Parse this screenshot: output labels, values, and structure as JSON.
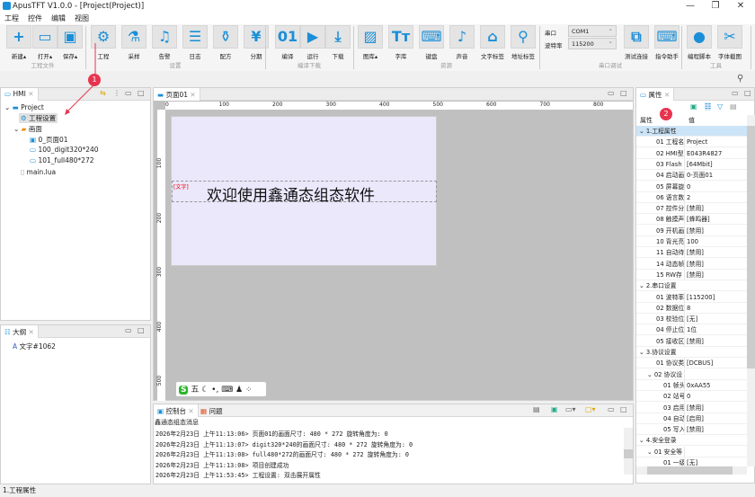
{
  "window": {
    "title": "ApusTFT V1.0.0 - [Project(Project)]",
    "min": "—",
    "max": "❐",
    "close": "✕"
  },
  "menu": [
    "工程",
    "控件",
    "编辑",
    "视图"
  ],
  "ribbon": {
    "groups": [
      "工程文件",
      "设置",
      "编译下载",
      "资源",
      "串口调试",
      "工具"
    ],
    "buttons": [
      {
        "label": "新建▴",
        "icon": "new-file-icon",
        "glyph": "+"
      },
      {
        "label": "打开▴",
        "icon": "open-folder-icon",
        "glyph": "▭"
      },
      {
        "label": "保存▴",
        "icon": "save-icon",
        "glyph": "▣"
      },
      {
        "label": "工程",
        "icon": "gear-icon",
        "glyph": "⚙"
      },
      {
        "label": "采样",
        "icon": "test-tube-icon",
        "glyph": "⚗"
      },
      {
        "label": "告警",
        "icon": "bell-icon",
        "glyph": "♫"
      },
      {
        "label": "日志",
        "icon": "log-icon",
        "glyph": "☰"
      },
      {
        "label": "配方",
        "icon": "recipe-icon",
        "glyph": "⚱"
      },
      {
        "label": "分期",
        "icon": "installment-icon",
        "glyph": "¥"
      },
      {
        "label": "编译",
        "icon": "compile-icon",
        "glyph": "01"
      },
      {
        "label": "运行",
        "icon": "play-icon",
        "glyph": "▶"
      },
      {
        "label": "下载",
        "icon": "download-icon",
        "glyph": "⤓"
      },
      {
        "label": "图库▴",
        "icon": "image-icon",
        "glyph": "▨"
      },
      {
        "label": "字库",
        "icon": "font-icon",
        "glyph": "Tт"
      },
      {
        "label": "键盘",
        "icon": "keyboard-icon",
        "glyph": "⌨"
      },
      {
        "label": "声音",
        "icon": "music-icon",
        "glyph": "♪"
      },
      {
        "label": "文字标签",
        "icon": "tag-icon",
        "glyph": "⌂"
      },
      {
        "label": "地址标签",
        "icon": "location-icon",
        "glyph": "⚲"
      },
      {
        "label": "测试连接",
        "icon": "network-icon",
        "glyph": "⧉"
      },
      {
        "label": "指令助手",
        "icon": "command-icon",
        "glyph": "⌨"
      },
      {
        "label": "编程脚本",
        "icon": "lua-icon",
        "glyph": "●"
      },
      {
        "label": "字体截图",
        "icon": "scissors-icon",
        "glyph": "✂"
      }
    ],
    "serial": {
      "port_label": "串口",
      "port_value": "COM1",
      "baud_label": "波特率",
      "baud_value": "115200"
    }
  },
  "hmi_panel": {
    "tab": "HMI",
    "tree": [
      "Project",
      "工程设置",
      "画面",
      "0_页面01",
      "100_digit320*240",
      "101_full480*272",
      "main.lua"
    ]
  },
  "outline_panel": {
    "tab": "大纲",
    "items": [
      "文字#1062"
    ]
  },
  "editor": {
    "tab": "页面01",
    "ruler_h": [
      "0",
      "100",
      "200",
      "300",
      "400",
      "500",
      "600",
      "700",
      "800"
    ],
    "ruler_v": [
      "100",
      "200",
      "300",
      "400",
      "500"
    ],
    "tag": "[文字]",
    "text": "欢迎使用鑫通态组态软件",
    "ime": "五"
  },
  "console": {
    "tabs": [
      "控制台",
      "问题"
    ],
    "header": "鑫通态组态消息",
    "lines": [
      "2026年2月23日 上午11:13:06> 页面01的画面尺寸: 480 * 272  旋转角度为: 0",
      "2026年2月23日 上午11:13:07> digit320*240的画面尺寸: 480 * 272  旋转角度为: 0",
      "2026年2月23日 上午11:13:08> full480*272的画面尺寸: 480 * 272  旋转角度为: 0",
      "2026年2月23日 上午11:13:08> 项目创建成功",
      "2026年2月23日 上午11:53:45> 工程设置: 双击展开属性"
    ]
  },
  "properties": {
    "tab": "属性",
    "col_key": "属性",
    "col_val": "值",
    "rows": [
      {
        "k": "⌄ 1.工程属性",
        "v": "",
        "lvl": 0,
        "sel": true
      },
      {
        "k": "01 工程名",
        "v": "Project",
        "lvl": 2
      },
      {
        "k": "02 HMI型",
        "v": "E043R4827",
        "lvl": 2
      },
      {
        "k": "03 Flash",
        "v": "[64Mbit]",
        "lvl": 2
      },
      {
        "k": "04 启动画",
        "v": "0-页面01",
        "lvl": 2
      },
      {
        "k": "05 屏幕旋",
        "v": "0",
        "lvl": 2
      },
      {
        "k": "06 语言数",
        "v": "2",
        "lvl": 2
      },
      {
        "k": "07 控件分",
        "v": "[禁用]",
        "lvl": 2
      },
      {
        "k": "08 触摸声",
        "v": "[蜂鸣器]",
        "lvl": 2
      },
      {
        "k": "09 开机画",
        "v": "[禁用]",
        "lvl": 2
      },
      {
        "k": "10 背光亮",
        "v": "100",
        "lvl": 2
      },
      {
        "k": "11 自动待",
        "v": "[禁用]",
        "lvl": 2
      },
      {
        "k": "14 动态帧",
        "v": "[禁用]",
        "lvl": 2
      },
      {
        "k": "15 RW存",
        "v": "[禁用]",
        "lvl": 2
      },
      {
        "k": "⌄ 2.串口设置",
        "v": "",
        "lvl": 0
      },
      {
        "k": "01 波特率",
        "v": "[115200]",
        "lvl": 2
      },
      {
        "k": "02 数据位",
        "v": "8",
        "lvl": 2
      },
      {
        "k": "03 校验位",
        "v": "[无]",
        "lvl": 2
      },
      {
        "k": "04 停止位",
        "v": "1位",
        "lvl": 2
      },
      {
        "k": "05 接收区",
        "v": "[禁用]",
        "lvl": 2
      },
      {
        "k": "⌄ 3.协议设置",
        "v": "",
        "lvl": 0
      },
      {
        "k": "01 协议类",
        "v": "[DCBUS]",
        "lvl": 2
      },
      {
        "k": "⌄ 02 协议设",
        "v": "",
        "lvl": 1
      },
      {
        "k": "01 帧头",
        "v": "0xAA55",
        "lvl": 3
      },
      {
        "k": "02 站号",
        "v": "0",
        "lvl": 3
      },
      {
        "k": "03 启用",
        "v": "[禁用]",
        "lvl": 3
      },
      {
        "k": "04 自动",
        "v": "[启用]",
        "lvl": 3
      },
      {
        "k": "05 写入",
        "v": "[禁用]",
        "lvl": 3
      },
      {
        "k": "⌄ 4.安全登录",
        "v": "",
        "lvl": 0
      },
      {
        "k": "⌄ 01 安全等",
        "v": "",
        "lvl": 1
      },
      {
        "k": "01 一级",
        "v": "[无]",
        "lvl": 3
      }
    ]
  },
  "statusbar": {
    "text": "1.工程属性"
  },
  "annotations": [
    "1",
    "2"
  ],
  "colors": {
    "accent": "#1a8fd8",
    "badge": "#e8344e",
    "screen": "#ebe8fc",
    "canvas": "#c0c0c0"
  }
}
